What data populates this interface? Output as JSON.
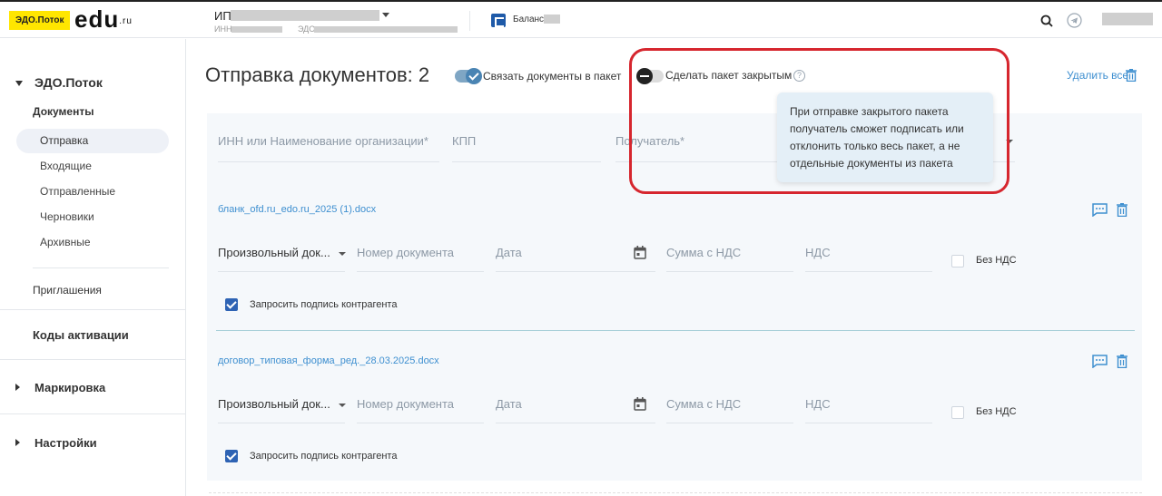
{
  "header": {
    "logo_badge": "ЭДО.Поток",
    "logo_text": "edu",
    "logo_suffix": ".ru",
    "org_type": "ИП",
    "inn_label": "ИНН",
    "edo_label": "ЭДО:",
    "balance_label": "Баланс"
  },
  "sidebar": {
    "section_edo": "ЭДО.Поток",
    "documents_label": "Документы",
    "items": [
      {
        "label": "Отправка",
        "active": true
      },
      {
        "label": "Входящие",
        "active": false
      },
      {
        "label": "Отправленные",
        "active": false
      },
      {
        "label": "Черновики",
        "active": false
      },
      {
        "label": "Архивные",
        "active": false
      }
    ],
    "invitations": "Приглашения",
    "activation_codes": "Коды активации",
    "marking": "Маркировка",
    "settings": "Настройки"
  },
  "main": {
    "title": "Отправка документов: 2",
    "toggle_link_label": "Связать документы в пакет",
    "toggle_link_on": true,
    "toggle_closed_label": "Сделать пакет закрытым",
    "toggle_closed_on": false,
    "help_symbol": "?",
    "delete_all": "Удалить все",
    "tooltip": "При отправке закрытого пакета получатель сможет подписать или отклонить только весь пакет, а не отдельные документы из пакета",
    "recipient": {
      "inn_placeholder": "ИНН или Наименование организации*",
      "kpp_placeholder": "КПП",
      "receiver_placeholder": "Получатель*"
    },
    "documents": [
      {
        "file_name": "бланк_ofd.ru_edo.ru_2025 (1).docx",
        "doc_type": "Произвольный док...",
        "number_placeholder": "Номер документа",
        "date_placeholder": "Дата",
        "sum_placeholder": "Сумма с НДС",
        "vat_placeholder": "НДС",
        "no_vat_label": "Без НДС",
        "no_vat_checked": false,
        "request_sign_label": "Запросить подпись контрагента",
        "request_sign_checked": true
      },
      {
        "file_name": "договор_типовая_форма_ред._28.03.2025.docx",
        "doc_type": "Произвольный док...",
        "number_placeholder": "Номер документа",
        "date_placeholder": "Дата",
        "sum_placeholder": "Сумма с НДС",
        "vat_placeholder": "НДС",
        "no_vat_label": "Без НДС",
        "no_vat_checked": false,
        "request_sign_label": "Запросить подпись контрагента",
        "request_sign_checked": true
      }
    ]
  },
  "colors": {
    "accent": "#3e8fd0",
    "highlight": "#d6262e",
    "logo_badge": "#ffe600",
    "checkbox": "#2e63b4"
  }
}
